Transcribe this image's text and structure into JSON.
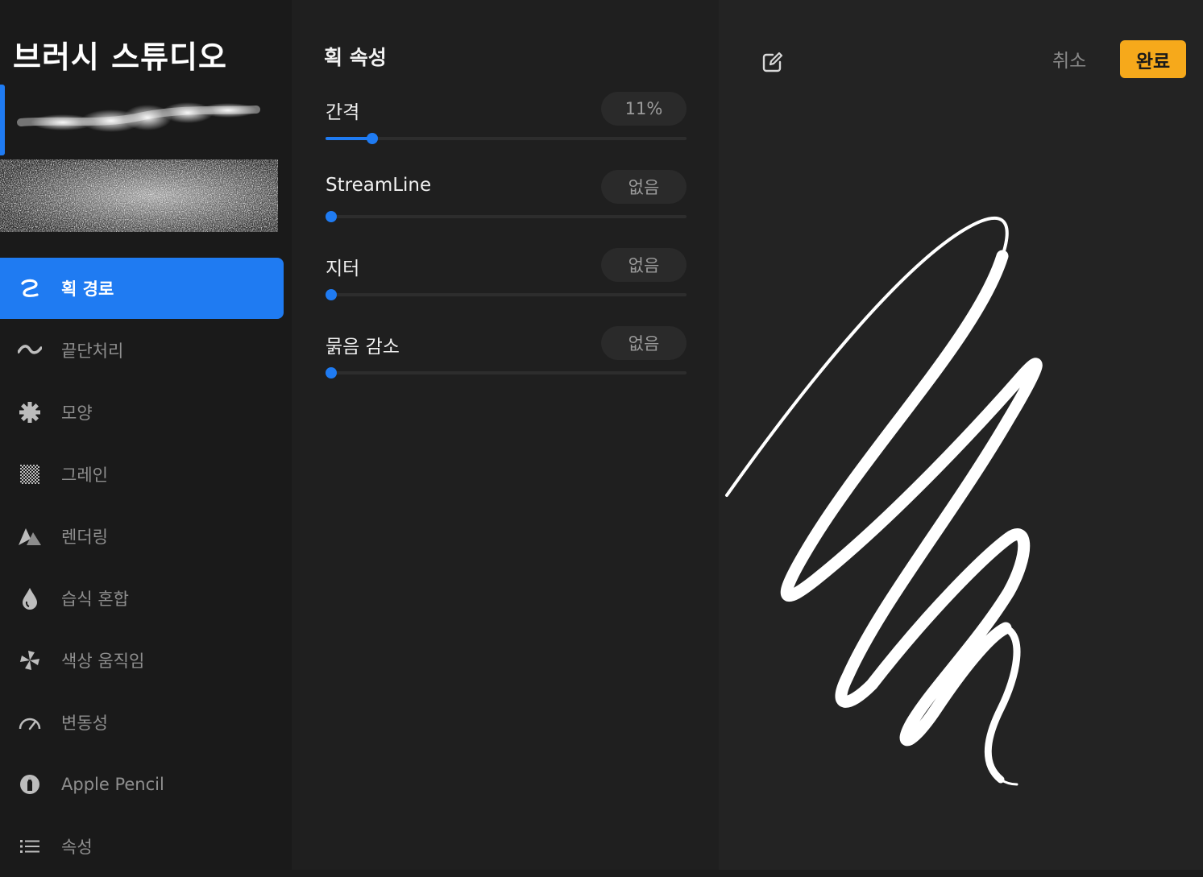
{
  "sidebar": {
    "title": "브러시 스튜디오",
    "items": [
      {
        "label": "획 경로",
        "icon": "stroke-path-icon",
        "active": true
      },
      {
        "label": "끝단처리",
        "icon": "taper-wave-icon",
        "active": false
      },
      {
        "label": "모양",
        "icon": "shape-gear-icon",
        "active": false
      },
      {
        "label": "그레인",
        "icon": "grain-checker-icon",
        "active": false
      },
      {
        "label": "렌더링",
        "icon": "rendering-peaks-icon",
        "active": false
      },
      {
        "label": "습식 혼합",
        "icon": "water-drop-icon",
        "active": false
      },
      {
        "label": "색상 움직임",
        "icon": "pinwheel-icon",
        "active": false
      },
      {
        "label": "변동성",
        "icon": "speedometer-icon",
        "active": false
      },
      {
        "label": "Apple Pencil",
        "icon": "apple-pencil-icon",
        "active": false
      },
      {
        "label": "속성",
        "icon": "list-icon",
        "active": false
      }
    ]
  },
  "settings": {
    "section_title": "획 속성",
    "params": [
      {
        "label": "간격",
        "value": "11%",
        "level": 0.13
      },
      {
        "label": "StreamLine",
        "value": "없음",
        "level": 0.0
      },
      {
        "label": "지터",
        "value": "없음",
        "level": 0.0
      },
      {
        "label": "묽음 감소",
        "value": "없음",
        "level": 0.0
      }
    ]
  },
  "pad": {
    "cancel_label": "취소",
    "done_label": "완료",
    "edit_icon": "edit-icon"
  },
  "colors": {
    "accent": "#1f7bf2",
    "done": "#f6a91b",
    "background": "#1b1b1b"
  }
}
